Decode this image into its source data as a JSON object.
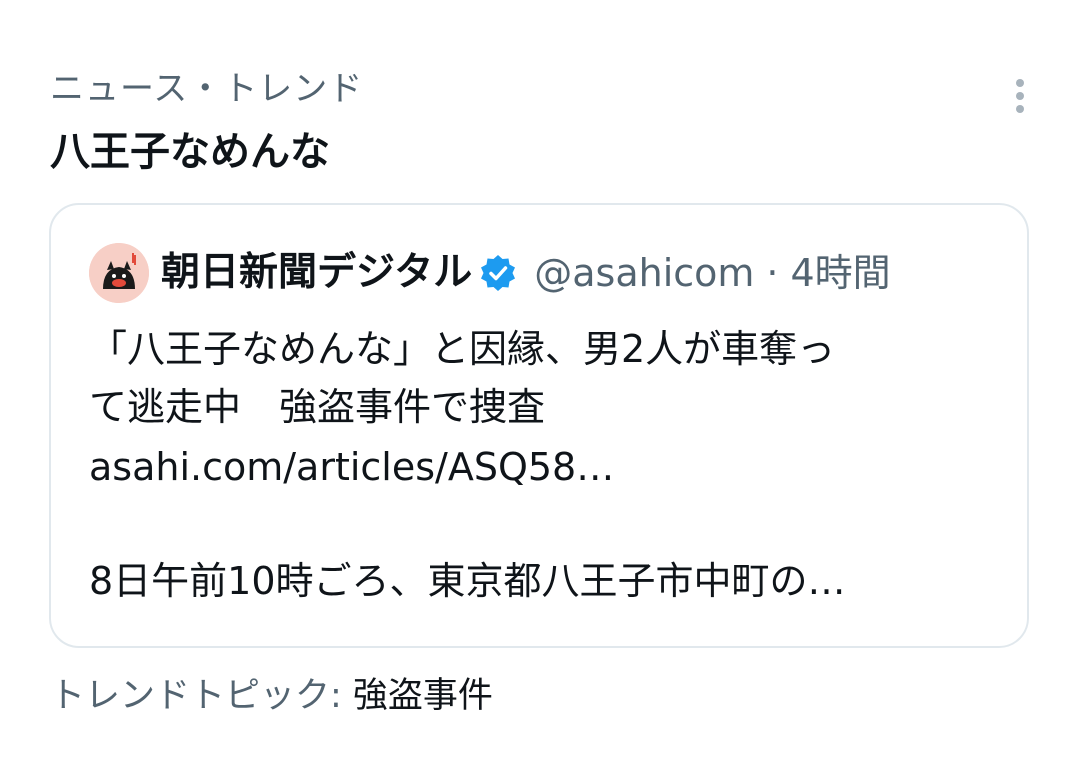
{
  "trend": {
    "category": "ニュース・トレンド",
    "title": "八王子なめんな",
    "more_icon": "more-vertical-icon"
  },
  "card": {
    "author_name": "朝日新聞デジタル",
    "verified_icon": "verified-badge-icon",
    "handle": "@asahicom",
    "separator": "·",
    "time": "4時間",
    "headline_line1": "「八王子なめんな」と因縁、男2人が車奪っ",
    "headline_line2": "て逃走中　強盗事件で捜査",
    "link": "asahi.com/articles/ASQ58…",
    "excerpt": "8日午前10時ごろ、東京都八王子市中町の…"
  },
  "topic": {
    "label": "トレンドトピック: ",
    "value": "強盗事件"
  },
  "colors": {
    "secondary_text": "#536471",
    "primary_text": "#0f1419",
    "verified_blue": "#1d9bf0",
    "border": "#e1e8ed"
  }
}
